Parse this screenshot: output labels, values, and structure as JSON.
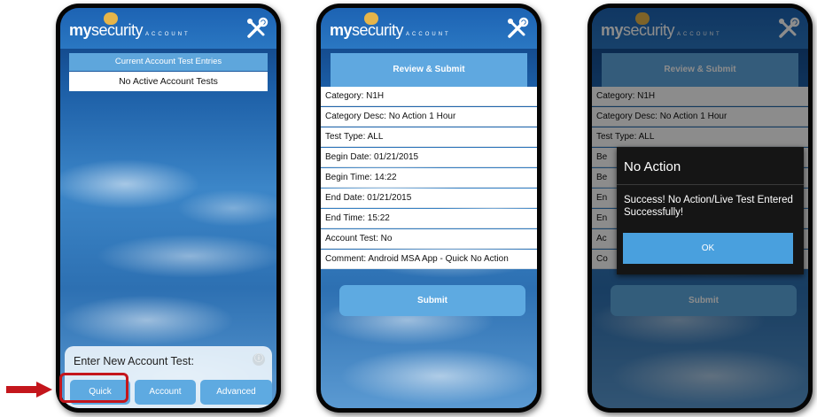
{
  "brand": {
    "logo_my": "my",
    "logo_security": "security",
    "logo_sub": "ACCOUNT"
  },
  "colors": {
    "header": "#2a77c2",
    "button": "#5eaae1",
    "highlight": "#c4161c",
    "dialog": "#151515"
  },
  "icons": {
    "tools": "wrench-screwdriver-icon",
    "info": "info-icon",
    "arrow": "red-arrow-icon"
  },
  "screen1": {
    "table_header": "Current Account Test Entries",
    "table_row": "No Active Account Tests",
    "entry_title": "Enter New Account Test:",
    "entry_icon_glyph": "ⓘ",
    "buttons": [
      "Quick",
      "Account",
      "Advanced"
    ]
  },
  "screen2": {
    "header": "Review & Submit",
    "fields": [
      "Category: N1H",
      "Category Desc: No Action 1 Hour",
      "Test Type: ALL",
      "Begin Date: 01/21/2015",
      "Begin Time: 14:22",
      "End Date: 01/21/2015",
      "End Time: 15:22",
      "Account Test: No",
      "Comment: Android MSA App - Quick No Action"
    ],
    "submit": "Submit"
  },
  "screen3": {
    "header": "Review & Submit",
    "fields": [
      "Category: N1H",
      "Category Desc: No Action 1 Hour",
      "Test Type: ALL",
      "Be",
      "Be",
      "En",
      "En",
      "Ac",
      "Co"
    ],
    "submit": "Submit",
    "dialog": {
      "title": "No Action",
      "message": "Success! No Action/Live Test Entered Successfully!",
      "ok": "OK"
    }
  }
}
